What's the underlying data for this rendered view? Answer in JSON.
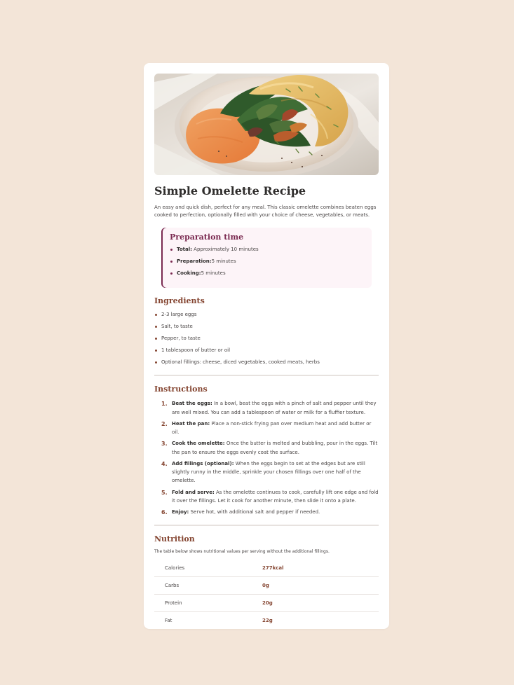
{
  "title": "Simple Omelette Recipe",
  "intro": "An easy and quick dish, perfect for any meal. This classic omelette combines beaten eggs cooked to perfection, optionally filled with your choice of cheese, vegetables, or meats.",
  "preparation": {
    "title": "Preparation time",
    "items": [
      {
        "label": "Total:",
        "value": " Approximately 10 minutes"
      },
      {
        "label": "Preparation:",
        "value": "5 minutes"
      },
      {
        "label": "Cooking:",
        "value": "5 minutes"
      }
    ]
  },
  "ingredients": {
    "title": "Ingredients",
    "items": [
      "2-3 large eggs",
      "Salt, to taste",
      "Pepper, to taste",
      "1 tablespoon of butter or oil",
      "Optional fillings: cheese, diced vegetables, cooked meats, herbs"
    ]
  },
  "instructions": {
    "title": "Instructions",
    "items": [
      {
        "num": "1.",
        "label": "Beat the eggs:",
        "text": " In a bowl, beat the eggs with a pinch of salt and pepper until they are well mixed. You can add a tablespoon of water or milk for a fluffier texture."
      },
      {
        "num": "2.",
        "label": "Heat the pan:",
        "text": " Place a non-stick frying pan over medium heat and add butter or oil."
      },
      {
        "num": "3.",
        "label": "Cook the omelette:",
        "text": " Once the butter is melted and bubbling, pour in the eggs. Tilt the pan to ensure the eggs evenly coat the surface."
      },
      {
        "num": "4.",
        "label": "Add fillings (optional):",
        "text": " When the eggs begin to set at the edges but are still slightly runny in the middle, sprinkle your chosen fillings over one half of the omelette."
      },
      {
        "num": "5.",
        "label": "Fold and serve:",
        "text": " As the omelette continues to cook, carefully lift one edge and fold it over the fillings. Let it cook for another minute, then slide it onto a plate."
      },
      {
        "num": "6.",
        "label": "Enjoy:",
        "text": " Serve hot, with additional salt and pepper if needed."
      }
    ]
  },
  "nutrition": {
    "title": "Nutrition",
    "description": "The table below shows nutritional values per serving without the additional fillings.",
    "rows": [
      {
        "name": "Calories",
        "value": "277kcal"
      },
      {
        "name": "Carbs",
        "value": "0g"
      },
      {
        "name": "Protein",
        "value": "20g"
      },
      {
        "name": "Fat",
        "value": "22g"
      }
    ]
  },
  "colors": {
    "background": "#f3e5d8",
    "card": "#ffffff",
    "accent_brown": "#854632",
    "accent_plum": "#7a2950",
    "prep_bg": "#fdf4f8"
  },
  "hero": {
    "icon": "omelette-photo"
  }
}
